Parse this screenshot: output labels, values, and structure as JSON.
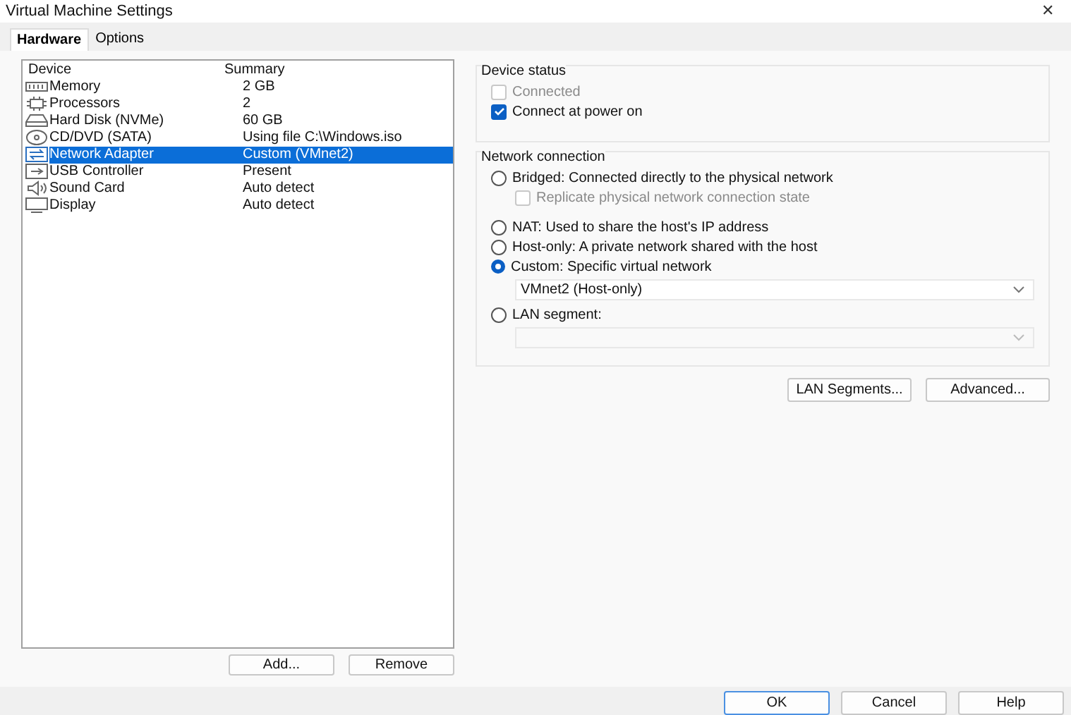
{
  "window": {
    "title": "Virtual Machine Settings",
    "close": "✕"
  },
  "tabs": [
    {
      "label": "Hardware",
      "selected": true
    },
    {
      "label": "Options",
      "selected": false
    }
  ],
  "device_list": {
    "columns": [
      "Device",
      "Summary"
    ],
    "rows": [
      {
        "kind": "memory",
        "device": "Memory",
        "summary": "2 GB",
        "selected": false
      },
      {
        "kind": "processor",
        "device": "Processors",
        "summary": "2",
        "selected": false
      },
      {
        "kind": "disk",
        "device": "Hard Disk (NVMe)",
        "summary": "60 GB",
        "selected": false
      },
      {
        "kind": "cd",
        "device": "CD/DVD (SATA)",
        "summary": "Using file C:\\Windows.iso",
        "selected": false
      },
      {
        "kind": "network",
        "device": "Network Adapter",
        "summary": "Custom (VMnet2)",
        "selected": true
      },
      {
        "kind": "usb",
        "device": "USB Controller",
        "summary": "Present",
        "selected": false
      },
      {
        "kind": "sound",
        "device": "Sound Card",
        "summary": "Auto detect",
        "selected": false
      },
      {
        "kind": "display",
        "device": "Display",
        "summary": "Auto detect",
        "selected": false
      }
    ]
  },
  "list_buttons": [
    "Add...",
    "Remove"
  ],
  "device_status": {
    "title": "Device status",
    "items": [
      {
        "label": "Connected",
        "checked": false,
        "disabled": true
      },
      {
        "label": "Connect at power on",
        "checked": true,
        "disabled": false
      }
    ]
  },
  "network_connection": {
    "title": "Network connection",
    "items": [
      {
        "kind": "radio",
        "label": "Bridged: Connected directly to the physical network",
        "selected": false
      },
      {
        "kind": "checkbox",
        "label": "Replicate physical network connection state",
        "checked": false,
        "disabled": true
      },
      {
        "kind": "radio",
        "label": "NAT: Used to share the host's IP address",
        "selected": false
      },
      {
        "kind": "radio",
        "label": "Host-only: A private network shared with the host",
        "selected": false
      },
      {
        "kind": "radio",
        "label": "Custom: Specific virtual network",
        "selected": true
      },
      {
        "kind": "select",
        "value": "VMnet2 (Host-only)",
        "disabled": false
      },
      {
        "kind": "radio",
        "label": "LAN segment:",
        "selected": false
      },
      {
        "kind": "select",
        "disabled": true
      }
    ]
  },
  "network_buttons": [
    "LAN Segments...",
    "Advanced..."
  ],
  "dialog_buttons": [
    {
      "label": "OK",
      "default": true
    },
    {
      "label": "Cancel",
      "default": false
    },
    {
      "label": "Help",
      "default": false
    }
  ]
}
